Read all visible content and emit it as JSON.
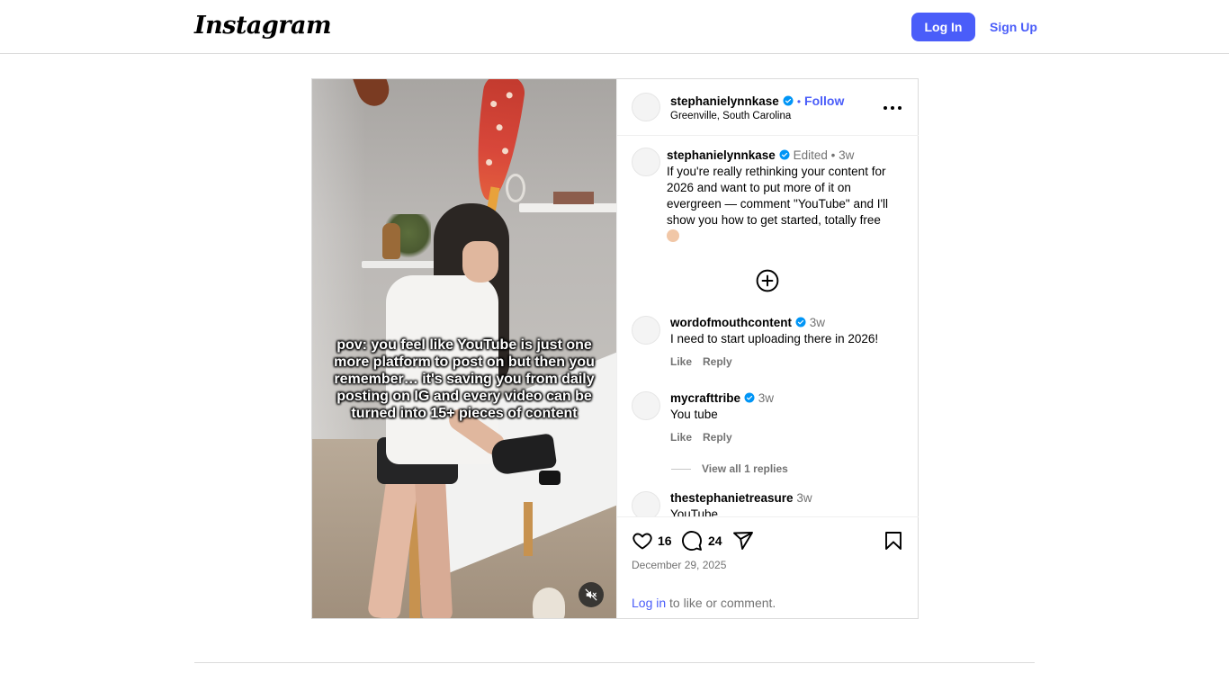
{
  "header": {
    "logo_text": "Instagram",
    "login_label": "Log In",
    "signup_label": "Sign Up"
  },
  "post": {
    "author": "stephanielynnkase",
    "follow_label": "Follow",
    "location": "Greenville, South Carolina",
    "video_overlay_text": "pov: you feel like YouTube is just one more platform to post on but then you remember… it's saving you from daily posting on IG and every video can be turned into 15+ pieces of content",
    "caption": {
      "user": "stephanielynnkase",
      "edited": "Edited",
      "separator": "•",
      "age": "3w",
      "text": "If you're really rethinking your content for 2026 and want to put more of it on evergreen — comment \"YouTube\" and I'll show you how to get started, totally free"
    },
    "comments": [
      {
        "user": "wordofmouthcontent",
        "age": "3w",
        "text": "I need to start uploading there in 2026!",
        "like_label": "Like",
        "reply_label": "Reply"
      },
      {
        "user": "mycrafttribe",
        "age": "3w",
        "text": "You tube",
        "like_label": "Like",
        "reply_label": "Reply",
        "view_replies": "View all 1 replies"
      },
      {
        "user": "thestephanietreasure",
        "age": "3w",
        "text": "YouTube"
      }
    ],
    "likes_count": "16",
    "comments_count": "24",
    "date": "December 29, 2025",
    "login_prompt": {
      "link": "Log in",
      "rest": " to like or comment."
    }
  },
  "colors": {
    "accent": "#4a5df9",
    "verified": "#0095f6",
    "muted_text": "#737373",
    "border": "#dbdbdb"
  },
  "icons": [
    "more-icon",
    "verified-icon",
    "plus-circle-icon",
    "heart-icon",
    "comment-icon",
    "share-icon",
    "bookmark-icon",
    "mute-icon"
  ]
}
